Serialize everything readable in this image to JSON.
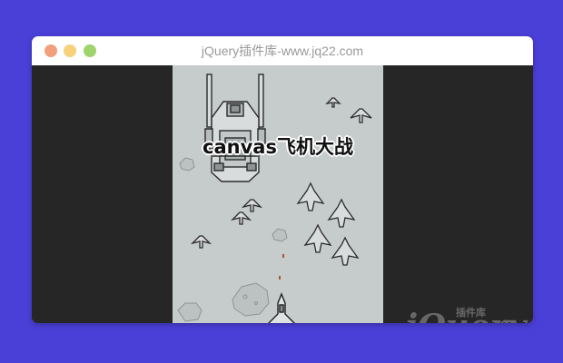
{
  "window": {
    "title": "jQuery插件库-www.jq22.com",
    "buttons": {
      "close_color": "#f2a07b",
      "minimize_color": "#f7d27a",
      "maximize_color": "#9fd36b"
    }
  },
  "game": {
    "title": "canvas飞机大战",
    "background_color": "#c6cbcb"
  },
  "watermark": {
    "main": "jQuery",
    "sub": "插件库"
  },
  "colors": {
    "page_background": "#4a3fd6",
    "frame_background": "#262626"
  }
}
